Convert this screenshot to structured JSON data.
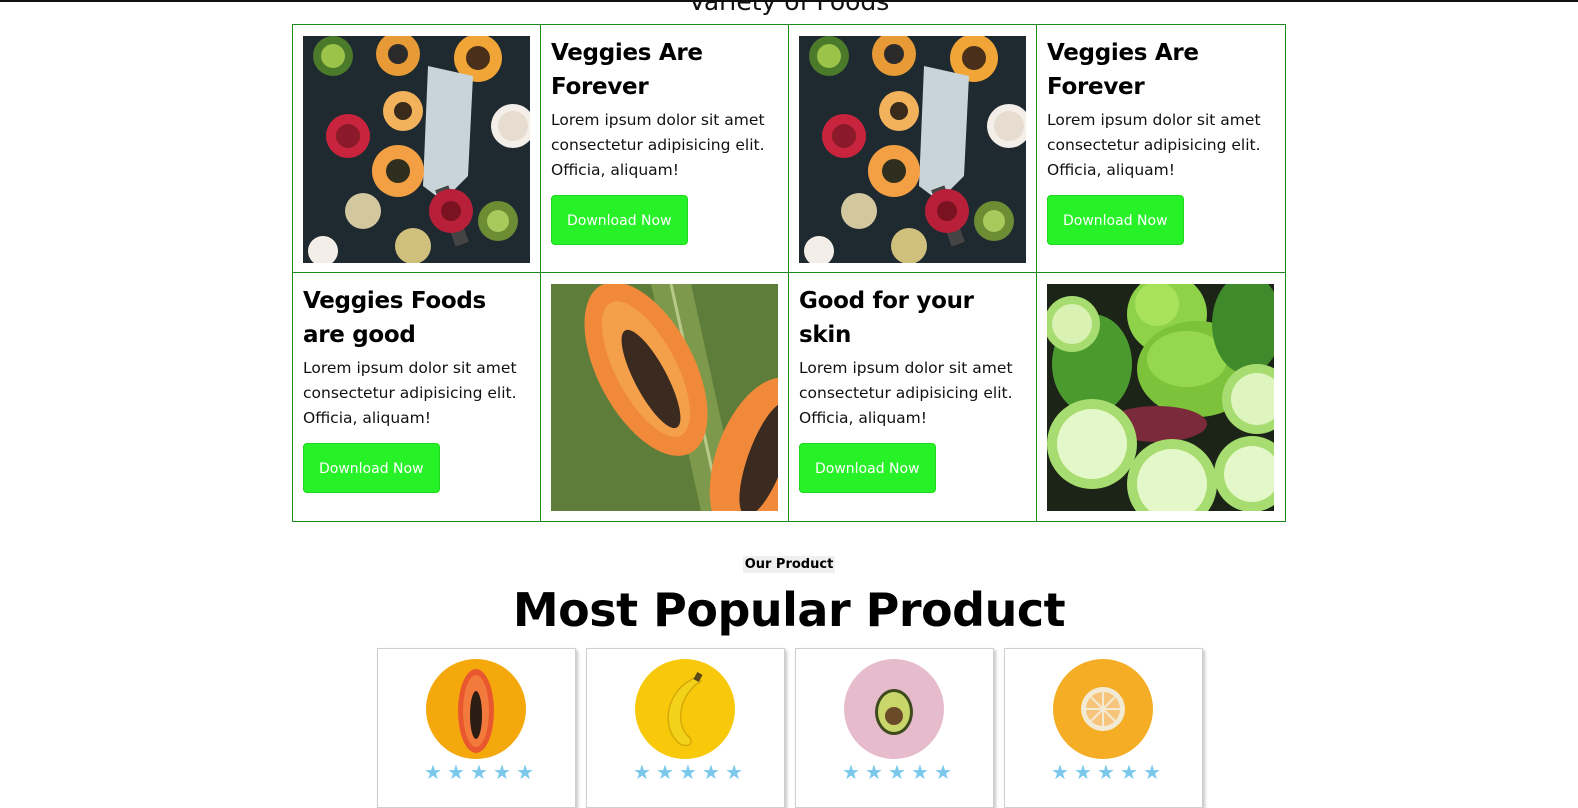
{
  "section": {
    "title": "Variety of Foods"
  },
  "grid": {
    "cards": [
      {
        "title": "Veggies Are Forever",
        "body": "Lorem ipsum dolor sit amet consectetur adipisicing elit. Officia, aliquam!",
        "button": "Download Now"
      },
      {
        "title": "Veggies Are Forever",
        "body": "Lorem ipsum dolor sit amet consectetur adipisicing elit. Officia, aliquam!",
        "button": "Download Now"
      },
      {
        "title": "Veggies Foods are good",
        "body": "Lorem ipsum dolor sit amet consectetur adipisicing elit. Officia, aliquam!",
        "button": "Download Now"
      },
      {
        "title": "Good for your skin",
        "body": "Lorem ipsum dolor sit amet consectetur adipisicing elit. Officia, aliquam!",
        "button": "Download Now"
      }
    ]
  },
  "products": {
    "eyebrow": "Our Product",
    "headline": "Most Popular Product",
    "items": [
      {
        "fruit": "papaya",
        "bg": "#f5a80c",
        "rating": 5
      },
      {
        "fruit": "banana",
        "bg": "#f7c90a",
        "rating": 5
      },
      {
        "fruit": "avocado",
        "bg": "#e6bccd",
        "rating": 5
      },
      {
        "fruit": "orange",
        "bg": "#f4ad24",
        "rating": 5
      }
    ]
  },
  "colors": {
    "accent": "#27f227",
    "grid_border": "#1a8a1a",
    "star": "#7cc8ec"
  }
}
